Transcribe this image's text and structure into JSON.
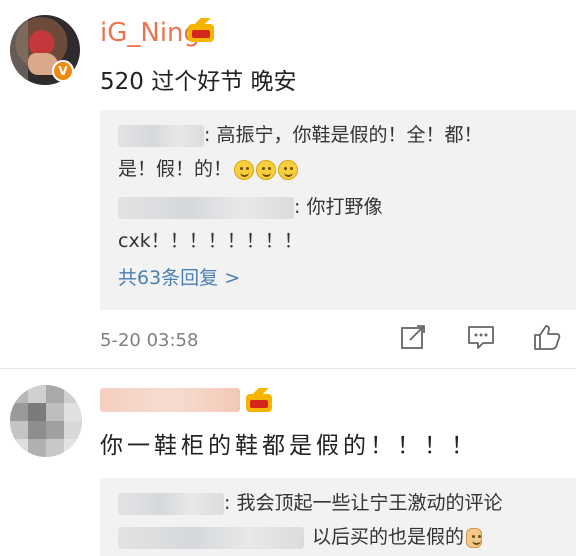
{
  "post": {
    "username": "iG_Ning",
    "verified_badge": "V",
    "text": "520 过个好节 晚安",
    "timestamp": "5-20 03:58",
    "replies": [
      {
        "text_1": ": 高振宁，你鞋是假的！全！都！",
        "text_2": "是！假！的！"
      },
      {
        "text_1": ": 你打野像",
        "text_2": "cxk！！！！！！！！"
      }
    ],
    "reply_count_label": "共63条回复 >",
    "actions": [
      "share-icon",
      "comment-icon",
      "like-icon"
    ]
  },
  "comment": {
    "text": "你一鞋柜的鞋都是假的！！！！",
    "replies": [
      {
        "text": ": 我会顶起一些让宁王激动的评论"
      },
      {
        "text": "以后买的也是假的"
      }
    ]
  },
  "colors": {
    "username": "#eb7350",
    "link": "#4b7fb3",
    "reply_bg": "#f2f2f2"
  }
}
